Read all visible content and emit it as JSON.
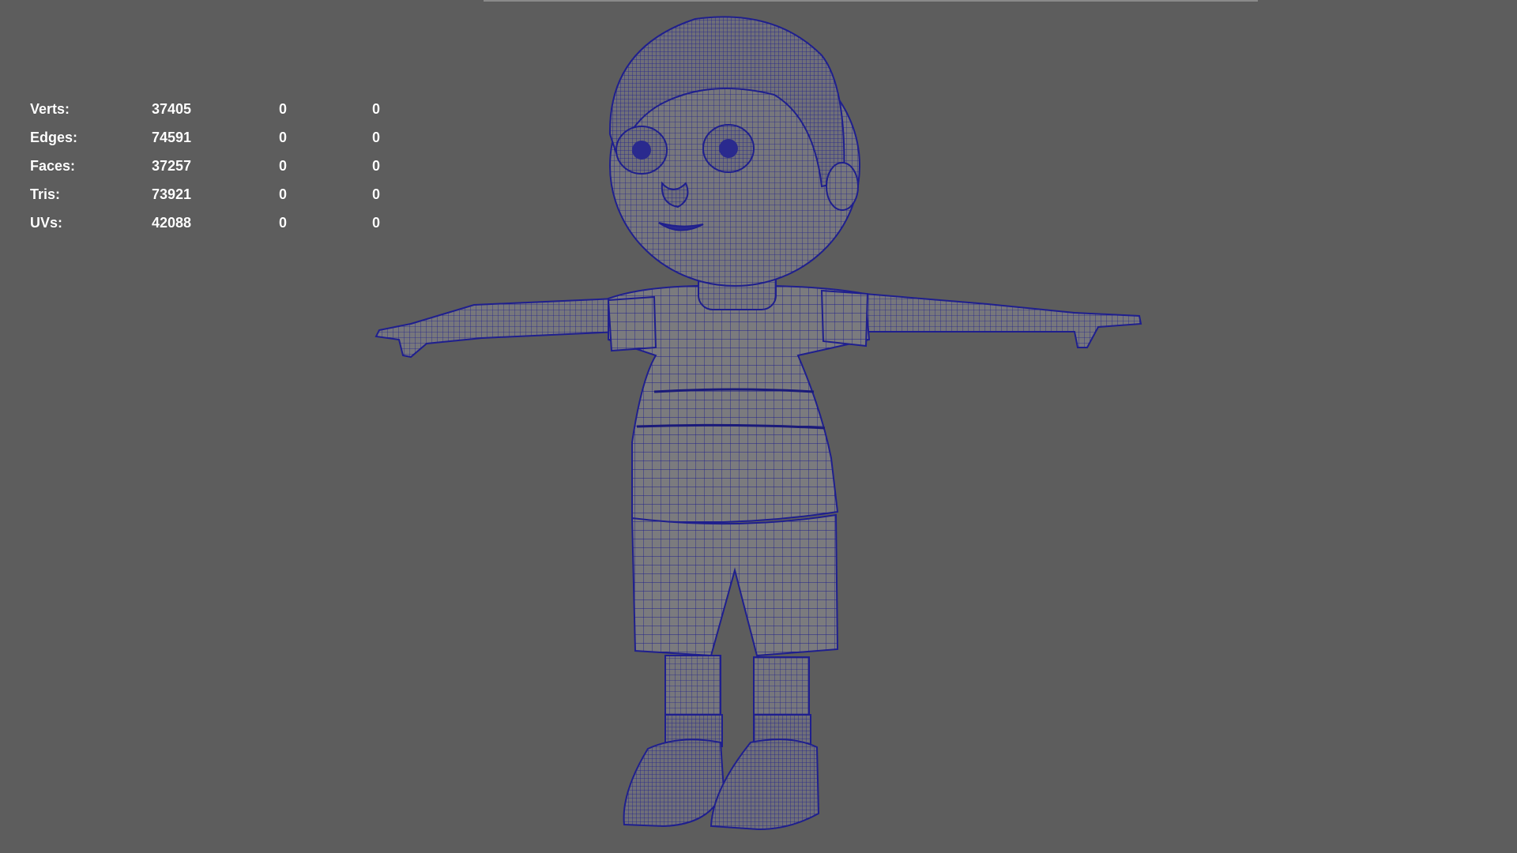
{
  "viewport": {
    "background": "#5d5d5d",
    "wire_color": "#1a1a8c",
    "surface_color": "#7a7a7a"
  },
  "hud": {
    "rows": [
      {
        "label": "Verts:",
        "values": [
          "37405",
          "0",
          "0"
        ]
      },
      {
        "label": "Edges:",
        "values": [
          "74591",
          "0",
          "0"
        ]
      },
      {
        "label": "Faces:",
        "values": [
          "37257",
          "0",
          "0"
        ]
      },
      {
        "label": "Tris:",
        "values": [
          "73921",
          "0",
          "0"
        ]
      },
      {
        "label": "UVs:",
        "values": [
          "42088",
          "0",
          "0"
        ]
      }
    ]
  }
}
